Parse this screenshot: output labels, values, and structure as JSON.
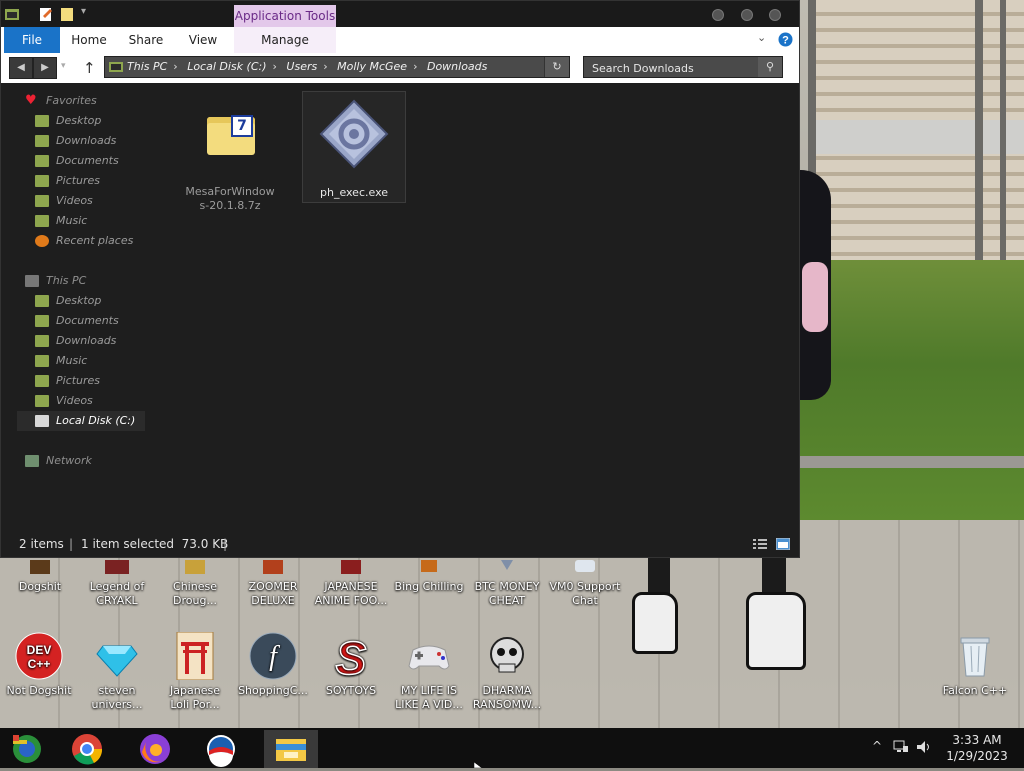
{
  "window": {
    "app_tools_label": "Application Tools",
    "tabs": [
      "File",
      "Home",
      "Share",
      "View",
      "Manage"
    ],
    "address": {
      "crumbs": [
        "This PC",
        "Local Disk (C:)",
        "Users",
        "Molly McGee",
        "Downloads"
      ]
    },
    "search": {
      "placeholder": "Search Downloads"
    },
    "nav": {
      "favorites": "Favorites",
      "favorites_items": [
        "Desktop",
        "Downloads",
        "Documents",
        "Pictures",
        "Videos",
        "Music",
        "Recent places"
      ],
      "this_pc": "This PC",
      "this_pc_items": [
        "Desktop",
        "Documents",
        "Downloads",
        "Music",
        "Pictures",
        "Videos",
        "Local Disk (C:)"
      ],
      "network": "Network"
    },
    "files": [
      {
        "name": "MesaForWindows-20.1.8.7z",
        "icon": "7zip-archive-icon",
        "selected": false
      },
      {
        "name": "ph_exec.exe",
        "icon": "executable-icon",
        "selected": true
      }
    ],
    "status": {
      "count": "2 items",
      "selection": "1 item selected  73.0 KB"
    }
  },
  "desktop": {
    "row1": [
      "Dogshit",
      "Legend of\nCRYAKL",
      "Chinese\nDroug...",
      "ZOOMER\nDELUXE",
      "JAPANESE\nANIME FOO...",
      "Bing Chilling",
      "BTC MONEY\nCHEAT",
      "VM0 Support\nChat"
    ],
    "row2": [
      "Not Dogshit",
      "steven\nunivers...",
      "Japanese\nLoli Por...",
      "ShoppingC...",
      "SOYTOYS",
      "MY LIFE IS\nLIKE A VID...",
      "DHARMA\nRANSOMW...",
      "Falcon C++"
    ]
  },
  "taskbar": {
    "time": "3:33 AM",
    "date": "1/29/2023",
    "pinned": [
      "chrome-like-icon",
      "google-chrome-icon",
      "firefox-icon",
      "obama-logo-icon",
      "file-explorer-icon"
    ]
  },
  "colors": {
    "file_tab": "#1a73c8",
    "app_tools": "#e3c8ea",
    "window_bg": "#1e1e1e"
  }
}
